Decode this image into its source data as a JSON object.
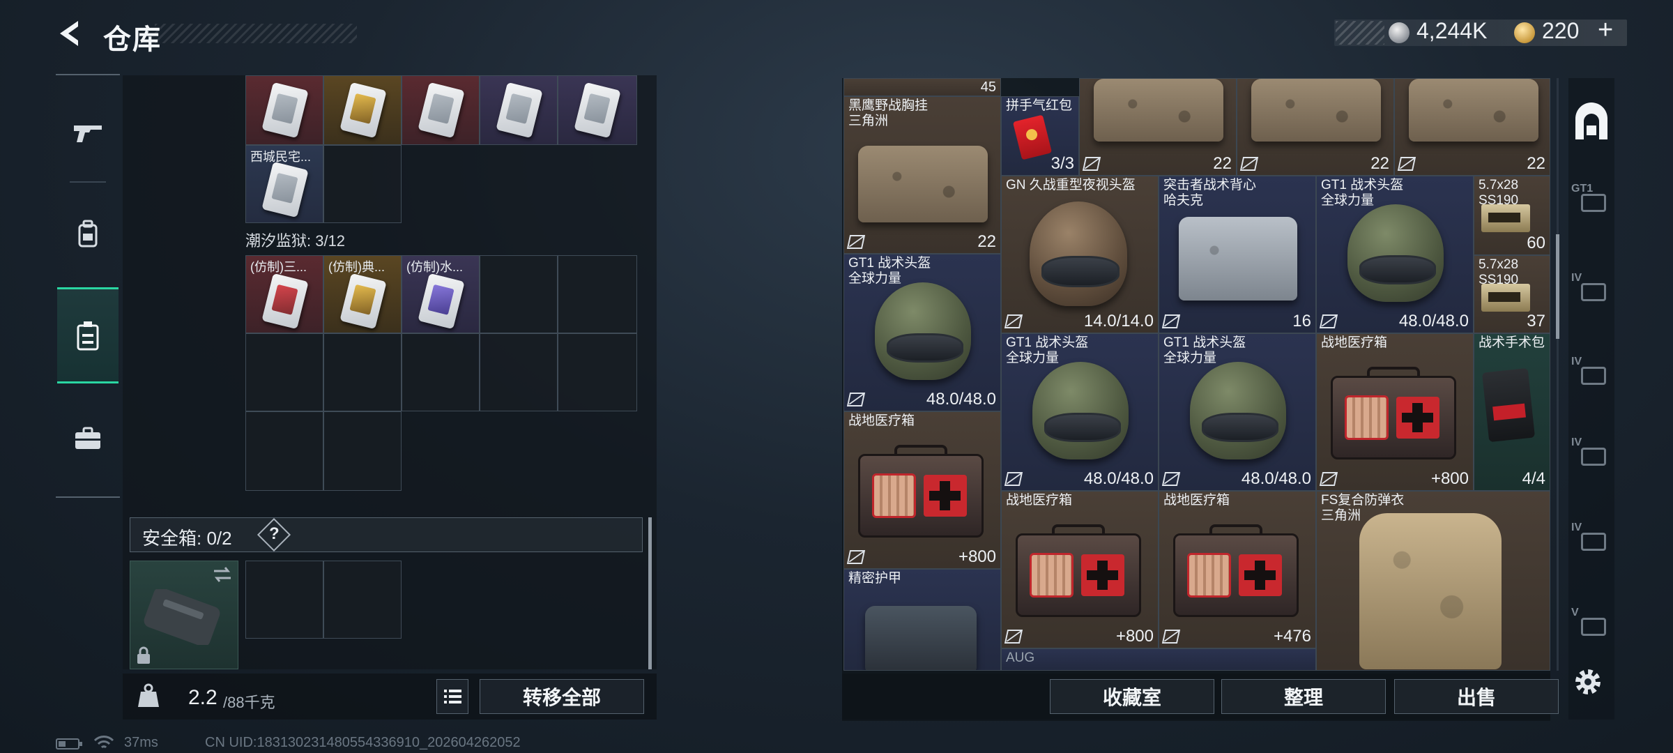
{
  "header": {
    "title": "仓库",
    "silver_amount": "4,244K",
    "gold_amount": "220",
    "gold_plus": "+"
  },
  "left_panel": {
    "top_row": [
      {
        "label": "",
        "rarity": "red"
      },
      {
        "label": "",
        "rarity": "gold"
      },
      {
        "label": "",
        "rarity": "red"
      },
      {
        "label": "",
        "rarity": "purple"
      },
      {
        "label": "",
        "rarity": "purple"
      }
    ],
    "second_row": [
      {
        "label": "西城民宅...",
        "rarity": "blue"
      }
    ],
    "prison_section": {
      "label": "潮汐监狱: 3/12",
      "items": [
        {
          "label": "(仿制)三...",
          "rarity": "red"
        },
        {
          "label": "(仿制)典...",
          "rarity": "gold"
        },
        {
          "label": "(仿制)水...",
          "rarity": "purple"
        }
      ]
    },
    "safe_box": {
      "label": "安全箱:  0/2",
      "help": "?"
    },
    "weight": {
      "current": "2.2",
      "max": "/88千克"
    },
    "transfer_all": "转移全部"
  },
  "stash": {
    "top_count": "45",
    "items": [
      {
        "name": "黑鹰野战胸挂",
        "sub": "三角洲",
        "value": "22",
        "kind": "bag"
      },
      {
        "name": "拼手气红包",
        "sub": "",
        "value": "3/3",
        "kind": "redpacket"
      },
      {
        "name": "",
        "sub": "",
        "value": "22",
        "kind": "bag"
      },
      {
        "name": "",
        "sub": "",
        "value": "22",
        "kind": "bag"
      },
      {
        "name": "",
        "sub": "",
        "value": "22",
        "kind": "bag"
      },
      {
        "name": "GN 久战重型夜视头盔",
        "sub": "",
        "value": "14.0/14.0",
        "kind": "helmet-nv"
      },
      {
        "name": "突击者战术背心",
        "sub": "哈夫克",
        "value": "16",
        "kind": "bag-grey"
      },
      {
        "name": "GT1 战术头盔",
        "sub": "全球力量",
        "value": "48.0/48.0",
        "kind": "helmet"
      },
      {
        "name": "5.7x28",
        "sub": "SS190",
        "value": "60",
        "kind": "ammo"
      },
      {
        "name": "GT1 战术头盔",
        "sub": "全球力量",
        "value": "48.0/48.0",
        "kind": "helmet"
      },
      {
        "name": "5.7x28",
        "sub": "SS190",
        "value": "37",
        "kind": "ammo"
      },
      {
        "name": "GT1 战术头盔",
        "sub": "全球力量",
        "value": "48.0/48.0",
        "kind": "helmet"
      },
      {
        "name": "GT1 战术头盔",
        "sub": "全球力量",
        "value": "48.0/48.0",
        "kind": "helmet"
      },
      {
        "name": "战地医疗箱",
        "sub": "",
        "value": "800",
        "kind": "medkit"
      },
      {
        "name": "战术手术包",
        "sub": "",
        "value": "4/4",
        "kind": "surgery"
      },
      {
        "name": "战地医疗箱",
        "sub": "",
        "value": "800",
        "kind": "medkit"
      },
      {
        "name": "战地医疗箱",
        "sub": "",
        "value": "800",
        "kind": "medkit"
      },
      {
        "name": "战地医疗箱",
        "sub": "",
        "value": "476",
        "kind": "medkit"
      },
      {
        "name": "FS复合防弹衣",
        "sub": "三角洲",
        "value": "",
        "kind": "vest"
      },
      {
        "name": "精密护甲",
        "sub": "",
        "value": "",
        "kind": "bag-grey"
      },
      {
        "name": "AUG",
        "sub": "",
        "value": "",
        "kind": "gun"
      }
    ],
    "value_plus": "+"
  },
  "right_rail": {
    "labels": [
      "GT1",
      "IV",
      "IV",
      "IV",
      "IV",
      "V"
    ]
  },
  "actions": {
    "collection": "收藏室",
    "sort": "整理",
    "sell": "出售"
  },
  "status_bar": {
    "ping": "37ms",
    "uid": "CN UID:1831302314805543369‌10_202604262052"
  },
  "colors": {
    "accent": "#2ad6a2",
    "rarity_red": "#5a2a30",
    "rarity_gold": "#5a4622",
    "rarity_purple": "#3a3554",
    "rarity_blue": "#2c3850",
    "panel_bg": "#10161c"
  },
  "icons": [
    "back-arrow-icon",
    "silver-coin-icon",
    "gold-coin-icon",
    "gun-icon",
    "backpack-icon",
    "storage-icon",
    "briefcase-icon",
    "help-icon",
    "weight-icon",
    "list-icon",
    "swap-icon",
    "lock-icon",
    "insured-icon",
    "plus-icon",
    "gear-icon",
    "wifi-icon",
    "battery-icon"
  ]
}
